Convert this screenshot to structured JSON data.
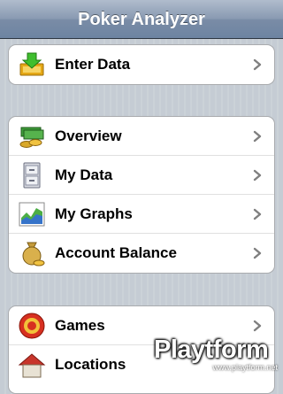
{
  "navbar": {
    "title": "Poker Analyzer"
  },
  "groups": [
    {
      "rows": [
        {
          "label": "Enter Data",
          "icon": "enter-data-icon"
        }
      ]
    },
    {
      "rows": [
        {
          "label": "Overview",
          "icon": "money-stack-icon"
        },
        {
          "label": "My Data",
          "icon": "file-cabinet-icon"
        },
        {
          "label": "My Graphs",
          "icon": "graph-icon"
        },
        {
          "label": "Account Balance",
          "icon": "money-bag-icon"
        }
      ]
    },
    {
      "rows": [
        {
          "label": "Games",
          "icon": "target-icon"
        },
        {
          "label": "Locations",
          "icon": "house-icon"
        }
      ]
    }
  ],
  "watermark": {
    "brand": "Playtform",
    "url": "www.playtform.net"
  }
}
